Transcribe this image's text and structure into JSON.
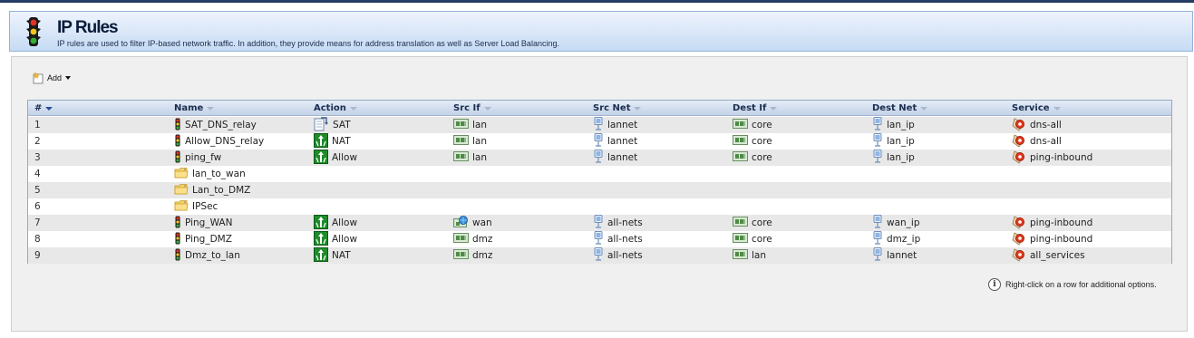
{
  "header": {
    "title": "IP Rules",
    "subtitle": "IP rules are used to filter IP-based network traffic. In addition, they provide means for address translation as well as Server Load Balancing."
  },
  "toolbar": {
    "add_label": "Add"
  },
  "table": {
    "columns": [
      "#",
      "Name",
      "Action",
      "Src If",
      "Src Net",
      "Dest If",
      "Dest Net",
      "Service"
    ],
    "rows": [
      {
        "num": "1",
        "name": "SAT_DNS_relay",
        "name_icon": "traffic-light-icon",
        "action": "SAT",
        "action_icon": "sat-icon",
        "src_if": "lan",
        "src_if_icon": "interface-icon",
        "src_net": "lannet",
        "dest_if": "core",
        "dest_if_icon": "interface-icon",
        "dest_net": "lan_ip",
        "service": "dns-all"
      },
      {
        "num": "2",
        "name": "Allow_DNS_relay",
        "name_icon": "traffic-light-icon",
        "action": "NAT",
        "action_icon": "nat-icon",
        "src_if": "lan",
        "src_if_icon": "interface-icon",
        "src_net": "lannet",
        "dest_if": "core",
        "dest_if_icon": "interface-icon",
        "dest_net": "lan_ip",
        "service": "dns-all"
      },
      {
        "num": "3",
        "name": "ping_fw",
        "name_icon": "traffic-light-icon",
        "action": "Allow",
        "action_icon": "allow-icon",
        "src_if": "lan",
        "src_if_icon": "interface-icon",
        "src_net": "lannet",
        "dest_if": "core",
        "dest_if_icon": "interface-icon",
        "dest_net": "lan_ip",
        "service": "ping-inbound"
      },
      {
        "num": "4",
        "name": "lan_to_wan",
        "name_icon": "folder-icon",
        "action": "",
        "action_icon": "",
        "src_if": "",
        "src_if_icon": "",
        "src_net": "",
        "dest_if": "",
        "dest_if_icon": "",
        "dest_net": "",
        "service": ""
      },
      {
        "num": "5",
        "name": "Lan_to_DMZ",
        "name_icon": "folder-icon",
        "action": "",
        "action_icon": "",
        "src_if": "",
        "src_if_icon": "",
        "src_net": "",
        "dest_if": "",
        "dest_if_icon": "",
        "dest_net": "",
        "service": ""
      },
      {
        "num": "6",
        "name": "IPSec",
        "name_icon": "folder-icon",
        "action": "",
        "action_icon": "",
        "src_if": "",
        "src_if_icon": "",
        "src_net": "",
        "dest_if": "",
        "dest_if_icon": "",
        "dest_net": "",
        "service": ""
      },
      {
        "num": "7",
        "name": "Ping_WAN",
        "name_icon": "traffic-light-icon",
        "action": "Allow",
        "action_icon": "allow-icon",
        "src_if": "wan",
        "src_if_icon": "wan-interface-icon",
        "src_net": "all-nets",
        "dest_if": "core",
        "dest_if_icon": "interface-icon",
        "dest_net": "wan_ip",
        "service": "ping-inbound"
      },
      {
        "num": "8",
        "name": "Ping_DMZ",
        "name_icon": "traffic-light-icon",
        "action": "Allow",
        "action_icon": "allow-icon",
        "src_if": "dmz",
        "src_if_icon": "interface-icon",
        "src_net": "all-nets",
        "dest_if": "core",
        "dest_if_icon": "interface-icon",
        "dest_net": "dmz_ip",
        "service": "ping-inbound"
      },
      {
        "num": "9",
        "name": "Dmz_to_lan",
        "name_icon": "traffic-light-icon",
        "action": "NAT",
        "action_icon": "nat-icon",
        "src_if": "dmz",
        "src_if_icon": "interface-icon",
        "src_net": "all-nets",
        "dest_if": "lan",
        "dest_if_icon": "interface-icon",
        "dest_net": "lannet",
        "service": "all_services"
      }
    ]
  },
  "hint": {
    "text": "Right-click on a row for additional options.",
    "icon_letter": "i"
  }
}
